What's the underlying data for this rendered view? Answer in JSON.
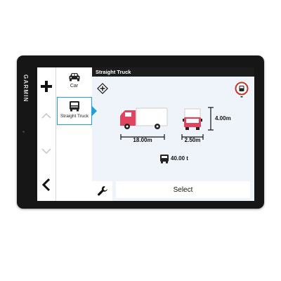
{
  "device": {
    "brand": "GARMIN"
  },
  "vehicles": [
    {
      "label": "Car",
      "selected": false
    },
    {
      "label": "Straight Truck",
      "selected": true
    }
  ],
  "profile": {
    "title": "Straight Truck",
    "length": "18.00m",
    "width": "2.50m",
    "height": "4.00m",
    "weight": "40.00 t"
  },
  "actions": {
    "select_label": "Select"
  },
  "colors": {
    "selection": "#22a0d6",
    "truck": "#e0445e",
    "title_bar": "#1c1c1c",
    "restriction": "#c0392b"
  },
  "icons": [
    "plus-icon",
    "chevron-up-icon",
    "chevron-down-icon",
    "back-icon",
    "car-icon",
    "truck-icon",
    "hazmat-icon",
    "restriction-icon",
    "weight-icon",
    "wrench-icon"
  ]
}
